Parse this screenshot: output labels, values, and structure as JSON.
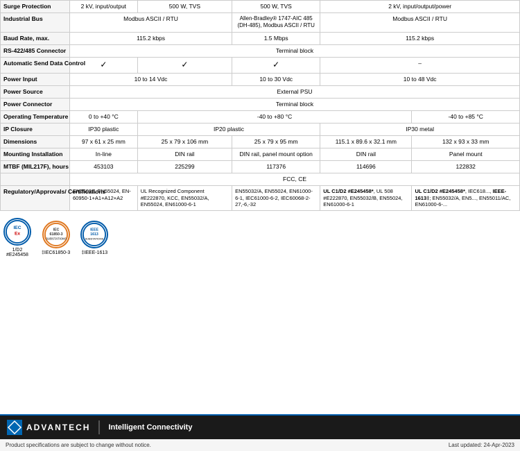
{
  "table": {
    "rows": [
      {
        "label": "Surge Protection",
        "cells": [
          "2 kV, input/output",
          "500 W, TVS",
          "500 W, TVS",
          "2 kV, input/output/power"
        ]
      },
      {
        "label": "Industrial Bus",
        "cells": [
          "Modbus ASCII / RTU",
          "",
          "Allen-Bradley® 1747-AIC 485 (DH-485), Modbus ASCII / RTU",
          "Modbus ASCII / RTU"
        ]
      },
      {
        "label": "Baud Rate, max.",
        "cells": [
          "115.2 kbps",
          "1.5 Mbps",
          "115.2 kbps",
          ""
        ]
      },
      {
        "label": "RS-422/485 Connector",
        "cells": [
          "Terminal block",
          "",
          "",
          ""
        ]
      },
      {
        "label": "Automatic Send Data Control",
        "cells": [
          "✓",
          "✓",
          "✓",
          "–"
        ]
      },
      {
        "label": "Power Input",
        "cells": [
          "10 to 14  Vdc",
          "10 to 30 Vdc",
          "10 to 48 Vdc",
          ""
        ]
      },
      {
        "label": "Power Source",
        "cells": [
          "External PSU",
          "",
          "",
          ""
        ]
      },
      {
        "label": "Power Connector",
        "cells": [
          "Terminal block",
          "",
          "",
          ""
        ]
      },
      {
        "label": "Operating Temperature",
        "cells": [
          "0 to +40 °C",
          "-40 to +80 °C",
          "-40 to +85 °C",
          ""
        ]
      },
      {
        "label": "IP Closure",
        "cells": [
          "IP30 plastic",
          "IP20 plastic",
          "IP30 metal",
          ""
        ]
      },
      {
        "label": "Dimensions",
        "cells": [
          "97 x 61 x 25 mm",
          "25 x 79 x 106 mm",
          "25 x 79 x 95 mm",
          "115.1 x 89.6 x 32.1 mm",
          "132 x 93 x 33 mm"
        ]
      },
      {
        "label": "Mounting Installation",
        "cells": [
          "In-line",
          "DIN rail",
          "DIN rail, panel mount option",
          "DIN rail",
          "Panel mount"
        ]
      },
      {
        "label": "MTBF (MIL217F), hours",
        "cells": [
          "453103",
          "225299",
          "117376",
          "114696",
          "122832"
        ]
      },
      {
        "label": "FCC_CE",
        "cells": [
          "FCC, CE"
        ]
      },
      {
        "label": "Regulatory/Approvals/Certifications",
        "cells": [
          "EN55032, EN55024, EN-60950-1+A1+A12+A2",
          "UL Recognized Component #E222870, KCC, EN55032/A, EN55024, EN61000-6-1",
          "EN55032/A, EN55024, EN61000-6-1, IEC61000-6-2, IEC60068-2-27,-6,-32",
          "UL C1/D2 #E245458*, UL 508 #E222870, EN55032/B, EN55024, EN61000-6-1",
          "UL C1/D2 #E245458*, IEC618..., IEEE-1613‡, EN55032/A, EN5..., EN55011/AC, EN61000-6-..."
        ]
      }
    ]
  },
  "logos": [
    {
      "id": "iecex",
      "line1": "IEC",
      "line2": "EX",
      "label": "1/D2\n#E245458"
    },
    {
      "id": "iec61850",
      "line1": "IEC",
      "line2": "61850-3",
      "label": "‡IEC61850-3"
    },
    {
      "id": "ieee1613",
      "line1": "IEEE",
      "line2": "1613",
      "label": "‡IEEE-1613"
    }
  ],
  "footer": {
    "brand": "ADVANTECH",
    "tagline": "Intelligent Connectivity",
    "disclaimer": "Product specifications are subject to change without notice.",
    "updated": "Last updated: 24-Apr-2023"
  }
}
